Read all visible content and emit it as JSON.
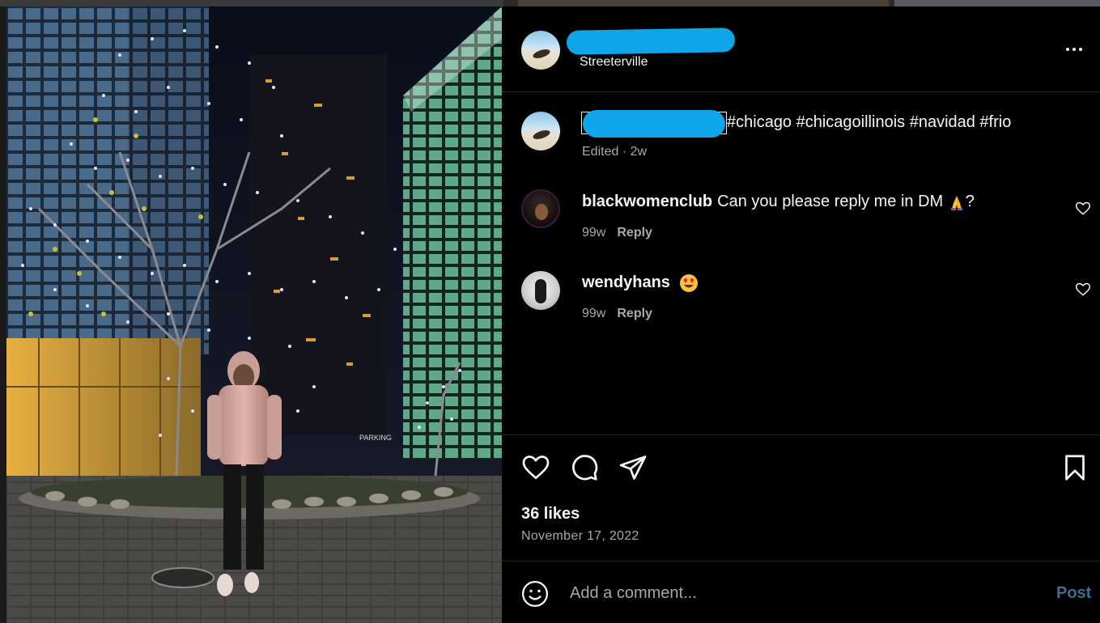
{
  "post": {
    "location": "Streeterville",
    "caption_hashtags": "#chicago #chicagoillinois #navidad #frio",
    "caption_meta": "Edited · 2w"
  },
  "comments": [
    {
      "user": "blackwomenclub",
      "text": "Can you please reply me in DM",
      "suffix": "?",
      "emoji": "folded-hands",
      "time": "99w",
      "reply_label": "Reply"
    },
    {
      "user": "wendyhans",
      "text": "",
      "suffix": "",
      "emoji": "heart-eyes",
      "time": "99w",
      "reply_label": "Reply"
    }
  ],
  "engagement": {
    "likes": "36 likes",
    "date": "November 17, 2022"
  },
  "composer": {
    "placeholder": "Add a comment...",
    "post_label": "Post"
  },
  "colors": {
    "background": "#000000",
    "redaction": "#0ea5e9",
    "post_button": "#3b6f93",
    "secondary_text": "#a8a8a8"
  },
  "icons": [
    "more-icon",
    "heart-icon",
    "comment-icon",
    "share-icon",
    "bookmark-icon",
    "emoji-icon",
    "heart-small-icon"
  ]
}
